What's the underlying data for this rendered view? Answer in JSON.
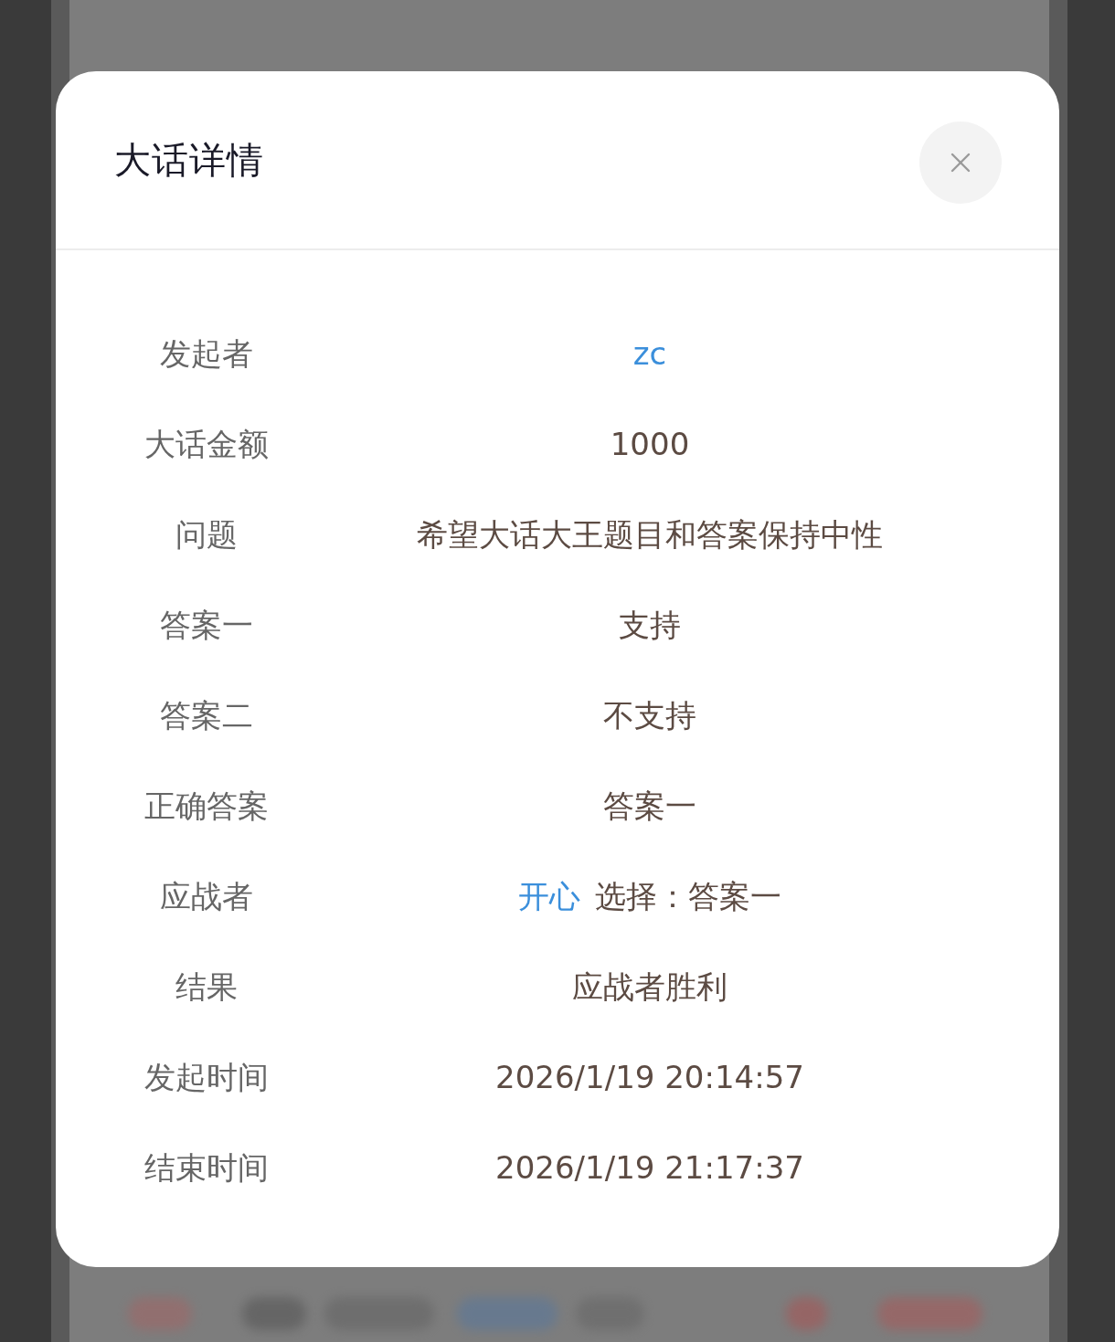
{
  "dialog": {
    "title": "大话详情"
  },
  "rows": [
    {
      "label": "发起者",
      "value": [
        {
          "kind": "link",
          "text": "zc"
        }
      ]
    },
    {
      "label": "大话金额",
      "value": [
        {
          "kind": "text",
          "text": "1000"
        }
      ]
    },
    {
      "label": "问题",
      "value": [
        {
          "kind": "text",
          "text": "希望大话大王题目和答案保持中性"
        }
      ]
    },
    {
      "label": "答案一",
      "value": [
        {
          "kind": "text",
          "text": "支持"
        }
      ]
    },
    {
      "label": "答案二",
      "value": [
        {
          "kind": "text",
          "text": "不支持"
        }
      ]
    },
    {
      "label": "正确答案",
      "value": [
        {
          "kind": "text",
          "text": "答案一"
        }
      ]
    },
    {
      "label": "应战者",
      "value": [
        {
          "kind": "link",
          "text": "开心"
        },
        {
          "kind": "text",
          "text": "选择：答案一"
        }
      ]
    },
    {
      "label": "结果",
      "value": [
        {
          "kind": "text",
          "text": "应战者胜利"
        }
      ]
    },
    {
      "label": "发起时间",
      "value": [
        {
          "kind": "text",
          "text": "2026/1/19 20:14:57"
        }
      ]
    },
    {
      "label": "结束时间",
      "value": [
        {
          "kind": "text",
          "text": "2026/1/19 21:17:37"
        }
      ]
    }
  ]
}
